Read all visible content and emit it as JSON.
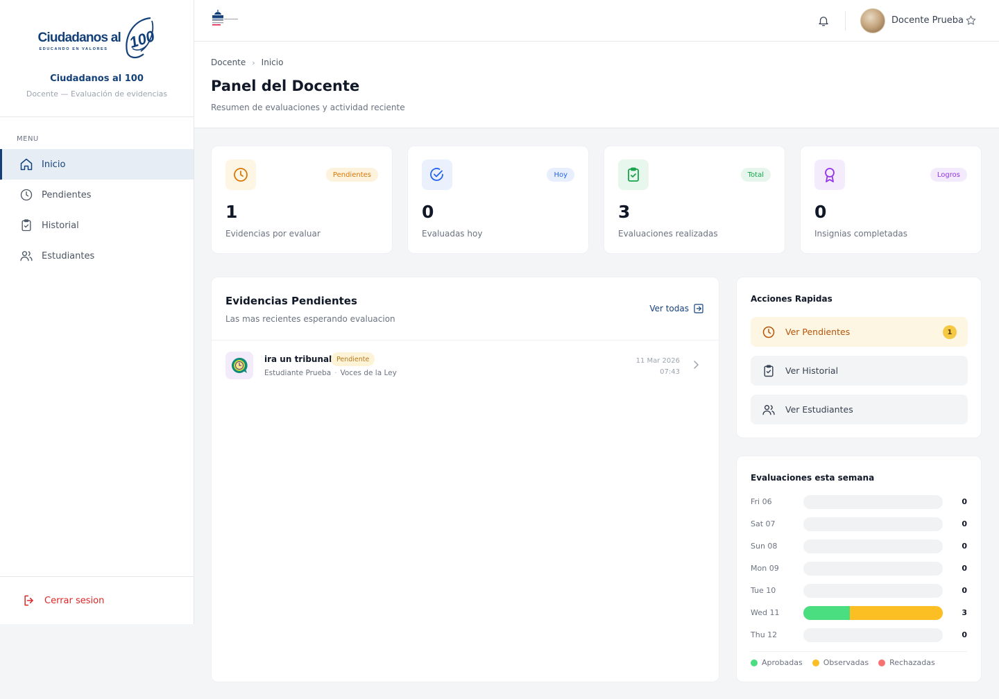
{
  "sidebar": {
    "logo_word": "Ciudadanos al",
    "logo_tag": "EDUCANDO EN VALORES",
    "logo_number": "100",
    "brand_name": "Ciudadanos al 100",
    "brand_sub": "Docente — Evaluación de evidencias",
    "menu_title": "MENU",
    "items": [
      {
        "label": "Inicio",
        "icon": "home-icon",
        "active": true
      },
      {
        "label": "Pendientes",
        "icon": "clock-icon",
        "active": false
      },
      {
        "label": "Historial",
        "icon": "clipboard-check-icon",
        "active": false
      },
      {
        "label": "Estudiantes",
        "icon": "users-icon",
        "active": false
      }
    ],
    "logout_label": "Cerrar sesion"
  },
  "topbar": {
    "user_name": "Docente Prueba"
  },
  "header": {
    "breadcrumb": [
      "Docente",
      "Inicio"
    ],
    "title": "Panel del Docente",
    "subtitle": "Resumen de evaluaciones y actividad reciente"
  },
  "stats": [
    {
      "badge": "Pendientes",
      "value": "1",
      "label": "Evidencias por evaluar",
      "icon": "clock-icon",
      "color": "#d97706",
      "bg": "#fef6e4",
      "badge_bg": "#fdf2dc"
    },
    {
      "badge": "Hoy",
      "value": "0",
      "label": "Evaluadas hoy",
      "icon": "check-circle-icon",
      "color": "#2563eb",
      "bg": "#eaf1fd",
      "badge_bg": "#e8effc"
    },
    {
      "badge": "Total",
      "value": "3",
      "label": "Evaluaciones realizadas",
      "icon": "clipboard-check-icon",
      "color": "#16a34a",
      "bg": "#e8f7ee",
      "badge_bg": "#e6f6ec"
    },
    {
      "badge": "Logros",
      "value": "0",
      "label": "Insignias completadas",
      "icon": "award-icon",
      "color": "#9333ea",
      "bg": "#f4ebfd",
      "badge_bg": "#f3eafd"
    }
  ],
  "evidence": {
    "title": "Evidencias Pendientes",
    "subtitle": "Las mas recientes esperando evaluacion",
    "see_all": "Ver todas",
    "items": [
      {
        "title": "ira un tribunal",
        "status": "Pendiente",
        "student": "Estudiante Prueba",
        "activity": "Voces de la Ley",
        "date": "11 Mar 2026",
        "time": "07:43"
      }
    ]
  },
  "quick_actions": {
    "title": "Acciones Rapidas",
    "items": [
      {
        "label": "Ver Pendientes",
        "icon": "clock-icon",
        "count": "1",
        "highlight": true
      },
      {
        "label": "Ver Historial",
        "icon": "clipboard-check-icon",
        "highlight": false
      },
      {
        "label": "Ver Estudiantes",
        "icon": "users-icon",
        "highlight": false
      }
    ]
  },
  "weekly": {
    "title": "Evaluaciones esta semana",
    "max": 3,
    "days": [
      {
        "day": "Fri 06",
        "approved": 0,
        "observed": 0,
        "rejected": 0,
        "total": "0"
      },
      {
        "day": "Sat 07",
        "approved": 0,
        "observed": 0,
        "rejected": 0,
        "total": "0"
      },
      {
        "day": "Sun 08",
        "approved": 0,
        "observed": 0,
        "rejected": 0,
        "total": "0"
      },
      {
        "day": "Mon 09",
        "approved": 0,
        "observed": 0,
        "rejected": 0,
        "total": "0"
      },
      {
        "day": "Tue 10",
        "approved": 0,
        "observed": 0,
        "rejected": 0,
        "total": "0"
      },
      {
        "day": "Wed 11",
        "approved": 1,
        "observed": 2,
        "rejected": 0,
        "total": "3"
      },
      {
        "day": "Thu 12",
        "approved": 0,
        "observed": 0,
        "rejected": 0,
        "total": "0"
      }
    ],
    "legend": [
      {
        "label": "Aprobadas",
        "color": "#4ade80"
      },
      {
        "label": "Observadas",
        "color": "#fbbf24"
      },
      {
        "label": "Rechazadas",
        "color": "#f87171"
      }
    ]
  }
}
